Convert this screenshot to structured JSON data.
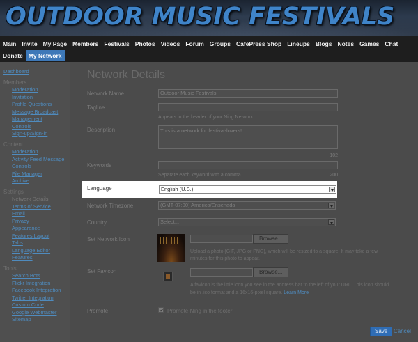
{
  "site": {
    "title": "OUTDOOR MUSIC FESTIVALS"
  },
  "nav": {
    "row1": [
      "Main",
      "Invite",
      "My Page",
      "Members",
      "Festivals",
      "Photos",
      "Videos",
      "Forum",
      "Groups",
      "CafePress Shop",
      "Lineups",
      "Blogs",
      "Notes",
      "Games",
      "Chat"
    ],
    "row2": [
      "Donate",
      "My Network"
    ],
    "active": "My Network"
  },
  "sidebar": {
    "dashboard": "Dashboard",
    "members_head": "Members",
    "members": [
      "Moderation",
      "Invitation",
      "Profile Questions",
      "Message Broadcast",
      "Management",
      "Controls",
      "Sign-up/Sign-in"
    ],
    "content_head": "Content",
    "content": [
      "Moderation",
      "Activity Feed Message",
      "Controls",
      "File Manager",
      "Archive"
    ],
    "settings_head": "Settings",
    "settings_current": "Network Details",
    "settings": [
      "Terms of Service",
      "Email",
      "Privacy",
      "Appearance",
      "Features Layout",
      "Tabs",
      "Language Editor",
      "Features"
    ],
    "tools_head": "Tools",
    "tools": [
      "Search Bots",
      "Flickr Integration",
      "Facebook Integration",
      "Twitter Integration",
      "Custom Code",
      "Google Webmaster",
      "Sitemap"
    ]
  },
  "main": {
    "title": "Network Details",
    "network_name": {
      "label": "Network Name",
      "value": "Outdoor Music Festivals"
    },
    "tagline": {
      "label": "Tagline",
      "value": "",
      "hint": "Appears in the header of your Ning Network"
    },
    "description": {
      "label": "Description",
      "value": "This is a network for festival-lovers!",
      "counter": "102"
    },
    "keywords": {
      "label": "Keywords",
      "value": "",
      "hint": "Separate each keyword with a comma",
      "counter": "200"
    },
    "language": {
      "label": "Language",
      "value": "English (U.S.)"
    },
    "timezone": {
      "label": "Network Timezone",
      "value": "(GMT-07:00) America/Ensenada"
    },
    "country": {
      "label": "Country",
      "value": "Select..."
    },
    "network_icon": {
      "label": "Set Network Icon",
      "browse": "Browse...",
      "help_line1": "Upload a photo (GIF, JPG or PNG), which will be resized to a square. It may take a few",
      "help_line2": "minutes for this photo to appear."
    },
    "favicon": {
      "label": "Set Favicon",
      "browse": "Browse...",
      "help_line1": "A favicon is the little icon you see in the address bar to the left of your URL. This icon should",
      "help_line2": "be in .ico format and a 16x16-pixel square.",
      "learn_more": "Learn More"
    },
    "promote": {
      "label": "Promote",
      "checkbox_label": "Promote Ning in the footer",
      "checked": true
    },
    "save": "Save",
    "cancel": "Cancel"
  }
}
